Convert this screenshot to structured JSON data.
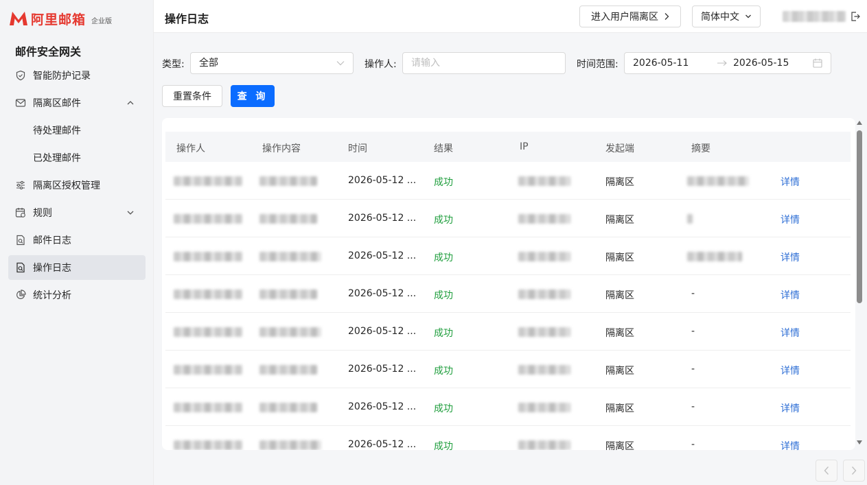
{
  "brand": {
    "name": "阿里邮箱",
    "edition": "企业版",
    "color": "#e5382f"
  },
  "sidebar": {
    "title": "邮件安全网关",
    "items": [
      {
        "label": "智能防护记录",
        "icon": "shield-icon"
      },
      {
        "label": "隔离区邮件",
        "icon": "mail-icon",
        "expanded": true
      },
      {
        "label": "待处理邮件",
        "sub": true
      },
      {
        "label": "已处理邮件",
        "sub": true
      },
      {
        "label": "隔离区授权管理",
        "icon": "sliders-icon"
      },
      {
        "label": "规则",
        "icon": "calendar-rule-icon",
        "expanded": false
      },
      {
        "label": "邮件日志",
        "icon": "doc-search-icon"
      },
      {
        "label": "操作日志",
        "icon": "doc-search-icon",
        "active": true
      },
      {
        "label": "统计分析",
        "icon": "pie-chart-icon"
      }
    ]
  },
  "header": {
    "title": "操作日志",
    "enter_quarantine": "进入用户隔离区",
    "language": "简体中文"
  },
  "filters": {
    "type_label": "类型:",
    "type_value": "全部",
    "operator_label": "操作人:",
    "operator_placeholder": "请输入",
    "range_label": "时间范围:",
    "range_start": "2026-05-11",
    "range_end": "2026-05-15",
    "reset_label": "重置条件",
    "query_label": "查 询"
  },
  "table": {
    "columns": [
      "操作人",
      "操作内容",
      "时间",
      "结果",
      "IP",
      "发起端",
      "摘要"
    ],
    "rows": [
      {
        "time": "2026-05-12 ...",
        "result": "成功",
        "source": "隔离区",
        "summary": "",
        "summary_blurred": true,
        "action": "详情"
      },
      {
        "time": "2026-05-12 ...",
        "result": "成功",
        "source": "隔离区",
        "summary": "",
        "summary_blurred": true,
        "action": "详情"
      },
      {
        "time": "2026-05-12 ...",
        "result": "成功",
        "source": "隔离区",
        "summary": "",
        "summary_blurred": true,
        "action": "详情"
      },
      {
        "time": "2026-05-12 ...",
        "result": "成功",
        "source": "隔离区",
        "summary": "-",
        "summary_blurred": false,
        "action": "详情"
      },
      {
        "time": "2026-05-12 ...",
        "result": "成功",
        "source": "隔离区",
        "summary": "-",
        "summary_blurred": false,
        "action": "详情"
      },
      {
        "time": "2026-05-12 ...",
        "result": "成功",
        "source": "隔离区",
        "summary": "-",
        "summary_blurred": false,
        "action": "详情"
      },
      {
        "time": "2026-05-12 ...",
        "result": "成功",
        "source": "隔离区",
        "summary": "-",
        "summary_blurred": false,
        "action": "详情"
      },
      {
        "time": "2026-05-12 ...",
        "result": "成功",
        "source": "隔离区",
        "summary": "-",
        "summary_blurred": false,
        "action": "详情"
      }
    ]
  },
  "colors": {
    "primary": "#0b6cff",
    "success": "#1f9e3d",
    "link": "#2f6fd6"
  }
}
